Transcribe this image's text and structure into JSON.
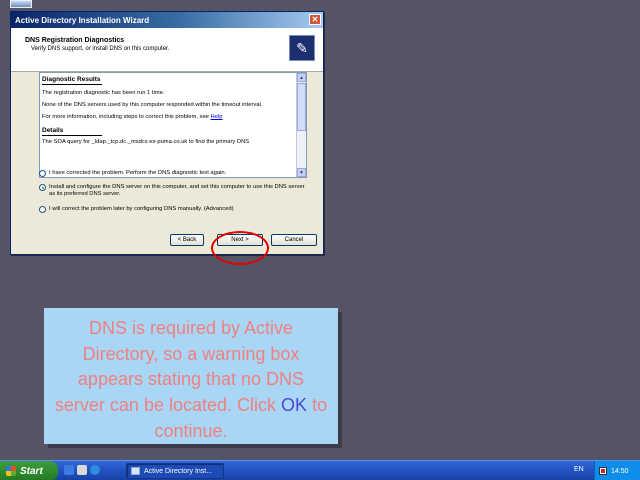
{
  "window": {
    "title": "Active Directory Installation Wizard",
    "close_glyph": "✕"
  },
  "header": {
    "title": "DNS Registration Diagnostics",
    "subtitle": "Verify DNS support, or install DNS on this computer."
  },
  "results": {
    "heading1": "Diagnostic Results",
    "line1": "The registration diagnostic has been run 1 time.",
    "line2": "None of the DNS servers used by this computer responded within the timeout interval.",
    "line3_prefix": "For more information, including steps to correct this problem, see ",
    "line3_link": "Help",
    "heading2": "Details",
    "line4": "The SOA query for _ldap._tcp.dc._msdcs.es-puma.co.uk to find the primary DNS"
  },
  "options": [
    {
      "label": "I have corrected the problem. Perform the DNS diagnostic test again.",
      "checked": false
    },
    {
      "label": "Install and configure the DNS server on this computer, and set this computer to use this DNS server as its preferred DNS server.",
      "checked": true
    },
    {
      "label": "I will correct the problem later by configuring DNS manually. (Advanced)",
      "checked": false
    }
  ],
  "buttons": {
    "back": "< Back",
    "next": "Next >",
    "cancel": "Cancel"
  },
  "info": {
    "text": "DNS is required by Active Directory, so a warning box appears stating that no DNS server can be located. Click",
    "ok": "OK",
    "suffix": "to continue."
  },
  "taskbar": {
    "start": "Start",
    "task_label": "Active Directory Inst...",
    "lang": "EN",
    "clock": "14:50"
  },
  "colors": {
    "desktop": "#545465",
    "info_bg": "#a9d6f5",
    "info_text": "#f08080",
    "ok_text": "#4a4ad8",
    "highlight": "#e00000"
  }
}
